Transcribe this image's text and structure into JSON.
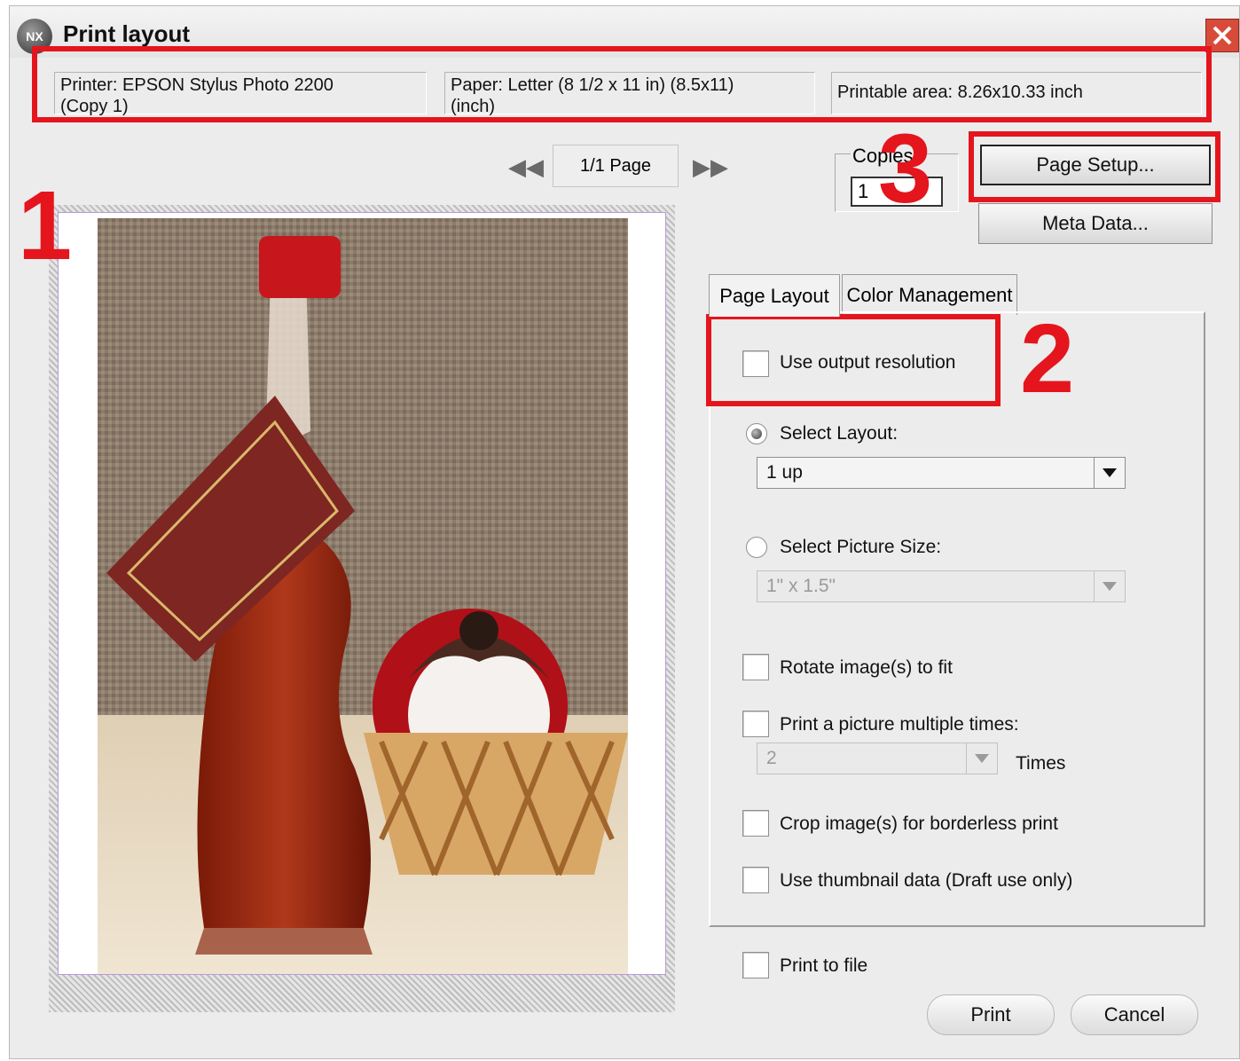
{
  "window": {
    "title": "Print layout",
    "logo_text": "NX"
  },
  "info": {
    "printer_line1": "Printer:  EPSON Stylus Photo 2200",
    "printer_line2": "(Copy 1)",
    "paper_line1": "Paper:  Letter (8 1/2 x 11 in) (8.5x11)",
    "paper_line2": "(inch)",
    "printable_area": "Printable area:  8.26x10.33 inch"
  },
  "pager": {
    "page_text": "1/1 Page",
    "prev_icon": "rewind-icon",
    "next_icon": "fast-forward-icon"
  },
  "copies": {
    "label": "Copies",
    "value": "1"
  },
  "buttons": {
    "page_setup": "Page Setup...",
    "meta_data": "Meta Data...",
    "print": "Print",
    "cancel": "Cancel"
  },
  "tabs": [
    {
      "label": "Page Layout",
      "active": true
    },
    {
      "label": "Color Management",
      "active": false
    }
  ],
  "options": {
    "use_output_resolution": "Use output resolution",
    "select_layout": "Select Layout:",
    "layout_value": "1 up",
    "select_picture_size": "Select Picture Size:",
    "picture_size_value": "1\" x 1.5\"",
    "rotate": "Rotate image(s) to fit",
    "print_multiple": "Print a picture multiple times:",
    "times_value": "2",
    "times_label": "Times",
    "crop": "Crop image(s) for borderless print",
    "thumbnail": "Use thumbnail data (Draft use only)",
    "print_to_file": "Print to file"
  },
  "annotations": {
    "one": "1",
    "two": "2",
    "three": "3"
  },
  "colors": {
    "annotation_red": "#e5151d",
    "dialog_bg": "#ececec"
  }
}
